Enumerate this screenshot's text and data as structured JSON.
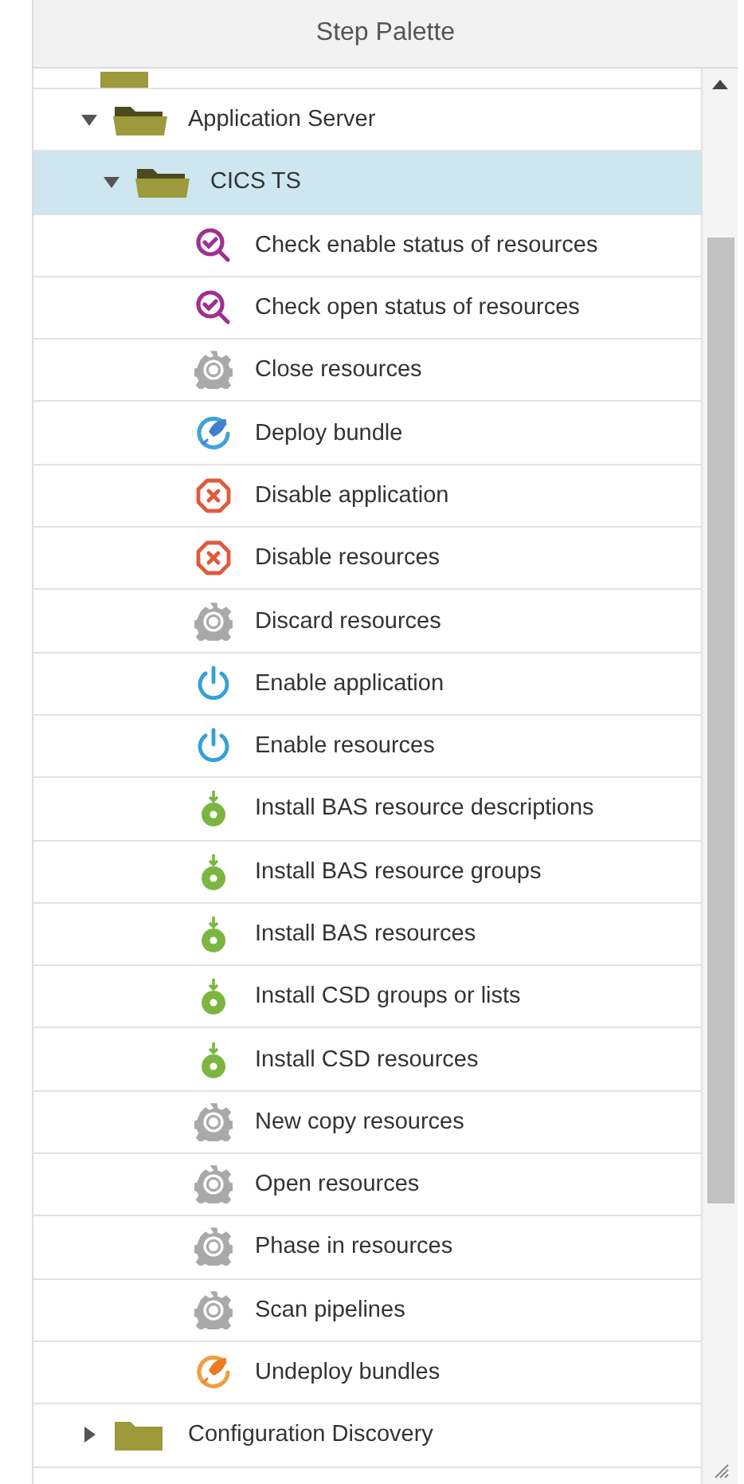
{
  "panel": {
    "title": "Step Palette"
  },
  "tree": [
    {
      "label": "Application Server",
      "expanded": true,
      "selected": false,
      "children": [
        {
          "label": "CICS TS",
          "expanded": true,
          "selected": true,
          "children": [
            {
              "label": "Check enable status of resources",
              "kind": "check",
              "selected": false
            },
            {
              "label": "Check open status of resources",
              "kind": "check",
              "selected": false
            },
            {
              "label": "Close resources",
              "kind": "gear",
              "selected": false
            },
            {
              "label": "Deploy bundle",
              "kind": "deploy",
              "selected": false
            },
            {
              "label": "Disable application",
              "kind": "disable",
              "selected": false
            },
            {
              "label": "Disable resources",
              "kind": "disable",
              "selected": false
            },
            {
              "label": "Discard resources",
              "kind": "gear",
              "selected": false
            },
            {
              "label": "Enable application",
              "kind": "enable",
              "selected": false
            },
            {
              "label": "Enable resources",
              "kind": "enable",
              "selected": false
            },
            {
              "label": "Install BAS resource descriptions",
              "kind": "install",
              "selected": false
            },
            {
              "label": "Install BAS resource groups",
              "kind": "install",
              "selected": false
            },
            {
              "label": "Install BAS resources",
              "kind": "install",
              "selected": false
            },
            {
              "label": "Install CSD groups or lists",
              "kind": "install",
              "selected": false
            },
            {
              "label": "Install CSD resources",
              "kind": "install",
              "selected": false
            },
            {
              "label": "New copy resources",
              "kind": "gear",
              "selected": false
            },
            {
              "label": "Open resources",
              "kind": "gear",
              "selected": false
            },
            {
              "label": "Phase in resources",
              "kind": "gear",
              "selected": false
            },
            {
              "label": "Scan pipelines",
              "kind": "gear",
              "selected": false
            },
            {
              "label": "Undeploy bundles",
              "kind": "undeploy",
              "selected": false
            }
          ]
        }
      ]
    },
    {
      "label": "Configuration Discovery",
      "expanded": false,
      "selected": false
    }
  ]
}
